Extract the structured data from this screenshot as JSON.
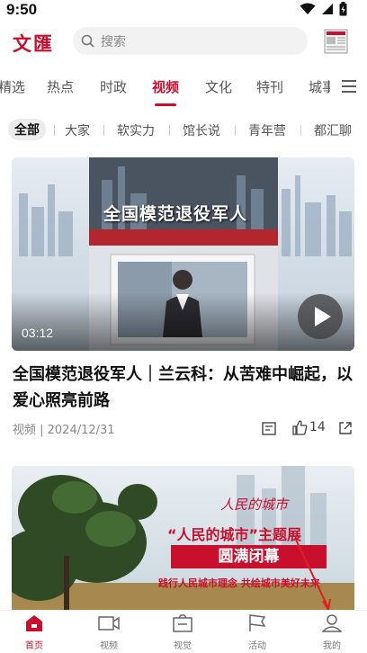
{
  "status_bar": {
    "time": "9:50"
  },
  "header": {
    "logo": "文匯",
    "search_placeholder": "搜索"
  },
  "tabs": [
    "精选",
    "热点",
    "时政",
    "视频",
    "文化",
    "特刊",
    "城事"
  ],
  "active_tab": "视频",
  "subtabs": [
    "全部",
    "大家",
    "软实力",
    "馆长说",
    "青年营",
    "都汇聊"
  ],
  "article1": {
    "duration": "03:12",
    "banner_text": "全国模范退役军人",
    "title": "全国模范退役军人｜兰云科：从苦难中崛起，以爱心照亮前路",
    "meta": "视频 | 2024/12/31",
    "likes": "14"
  },
  "article2": {
    "overlay_calligraphy": "人民的城市",
    "overlay_title": "“人民的城市”主题展",
    "overlay_banner": "圆满闭幕",
    "overlay_slogan": "践行人民城市理念 共绘城市美好未来"
  },
  "bottom_nav": [
    {
      "label": "首页",
      "icon": "home-icon"
    },
    {
      "label": "视频",
      "icon": "video-icon"
    },
    {
      "label": "视觉",
      "icon": "vision-icon"
    },
    {
      "label": "活动",
      "icon": "flag-icon"
    },
    {
      "label": "我的",
      "icon": "profile-icon"
    }
  ],
  "colors": {
    "accent": "#c8102e",
    "text": "#222222",
    "muted": "#888888"
  }
}
